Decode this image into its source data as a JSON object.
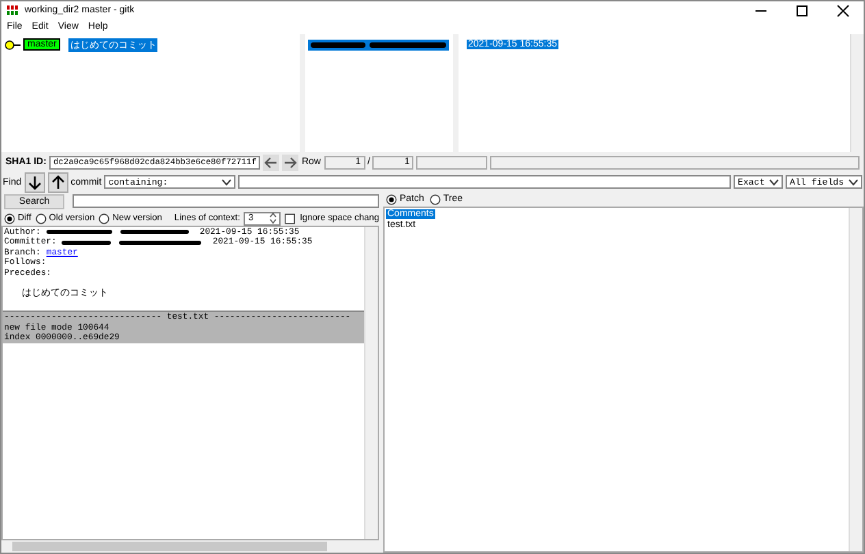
{
  "window": {
    "title": "working_dir2 master - gitk"
  },
  "menu": [
    "File",
    "Edit",
    "View",
    "Help"
  ],
  "commits": [
    {
      "ref": "master",
      "subject": "はじめてのコミット",
      "date": "2021-09-15 16:55:35",
      "selected": true
    }
  ],
  "sha1": {
    "label": "SHA1 ID:",
    "value": "dc2a0ca9c65f968d02cda824bb3e6ce80f72711f"
  },
  "row": {
    "label": "Row",
    "current": "1",
    "separator": "/",
    "total": "1"
  },
  "find": {
    "label": "Find",
    "type_label": "commit",
    "mode": "containing:",
    "match": "Exact",
    "fields": "All fields"
  },
  "search": {
    "button": "Search"
  },
  "view_options": [
    {
      "label": "Diff",
      "selected": true
    },
    {
      "label": "Old version",
      "selected": false
    },
    {
      "label": "New version",
      "selected": false
    }
  ],
  "context": {
    "label": "Lines of context:",
    "value": "3"
  },
  "ignore_space": {
    "label": "Ignore space chang",
    "checked": false
  },
  "pane_tabs": [
    {
      "label": "Patch",
      "selected": true
    },
    {
      "label": "Tree",
      "selected": false
    }
  ],
  "details": {
    "author_label": "Author:",
    "author_date": "2021-09-15 16:55:35",
    "committer_label": "Committer:",
    "committer_date": "2021-09-15 16:55:35",
    "branch_label": "Branch:",
    "branch": "master",
    "follows": "Follows:",
    "precedes": "Precedes:",
    "message": "はじめてのコミット"
  },
  "diff": {
    "header": "------------------------------ test.txt --------------------------",
    "lines": [
      "new file mode 100644",
      "index 0000000..e69de29"
    ]
  },
  "files": [
    {
      "name": "Comments",
      "selected": true
    },
    {
      "name": "test.txt",
      "selected": false
    }
  ]
}
